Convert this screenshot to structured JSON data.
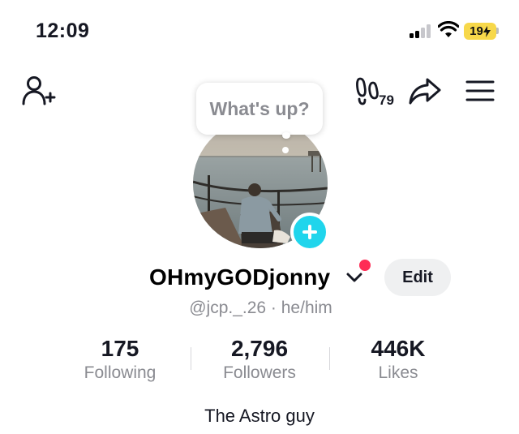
{
  "status_bar": {
    "time": "12:09",
    "battery_level": "19",
    "battery_color": "#f7d84a",
    "signal_bars_active": 2,
    "signal_bars_total": 4
  },
  "nav": {
    "left_icon": "add-friend-icon",
    "footprint_icon": "footprint-icon",
    "footprint_count": "79",
    "share_icon": "share-arrow-icon",
    "menu_icon": "hamburger-menu-icon"
  },
  "bubble": {
    "text": "What's up?"
  },
  "profile": {
    "username": "OHmyGODjonny",
    "handle_line": "@jcp._.26 · he/him",
    "edit_label": "Edit",
    "bio": "The Astro guy",
    "accent_color": "#20d5ec",
    "notification_color": "#fe2c55"
  },
  "stats": {
    "following": {
      "value": "175",
      "label": "Following"
    },
    "followers": {
      "value": "2,796",
      "label": "Followers"
    },
    "likes": {
      "value": "446K",
      "label": "Likes"
    }
  }
}
